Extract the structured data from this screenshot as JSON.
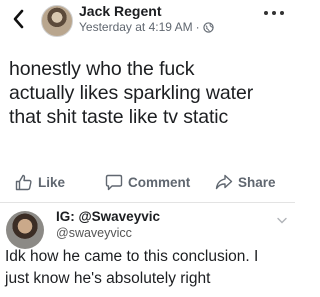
{
  "post": {
    "author_name": "Jack Regent",
    "timestamp": "Yesterday at 4:19 AM",
    "separator": "·",
    "audience_icon": "globe-icon",
    "text_lines": [
      "honestly who the fuck",
      "actually likes sparkling water",
      "that shit taste like tv static"
    ]
  },
  "actions": {
    "like_label": "Like",
    "comment_label": "Comment",
    "share_label": "Share"
  },
  "comment": {
    "author_name": "IG: @Swaveyvic",
    "handle": "@swaveyvicc",
    "text_lines": [
      "Idk how he came to this conclusion. I",
      "just know he's absolutely right"
    ]
  },
  "colors": {
    "text_primary": "#1c1e21",
    "text_secondary": "#606770",
    "divider": "#e3e3e3"
  }
}
